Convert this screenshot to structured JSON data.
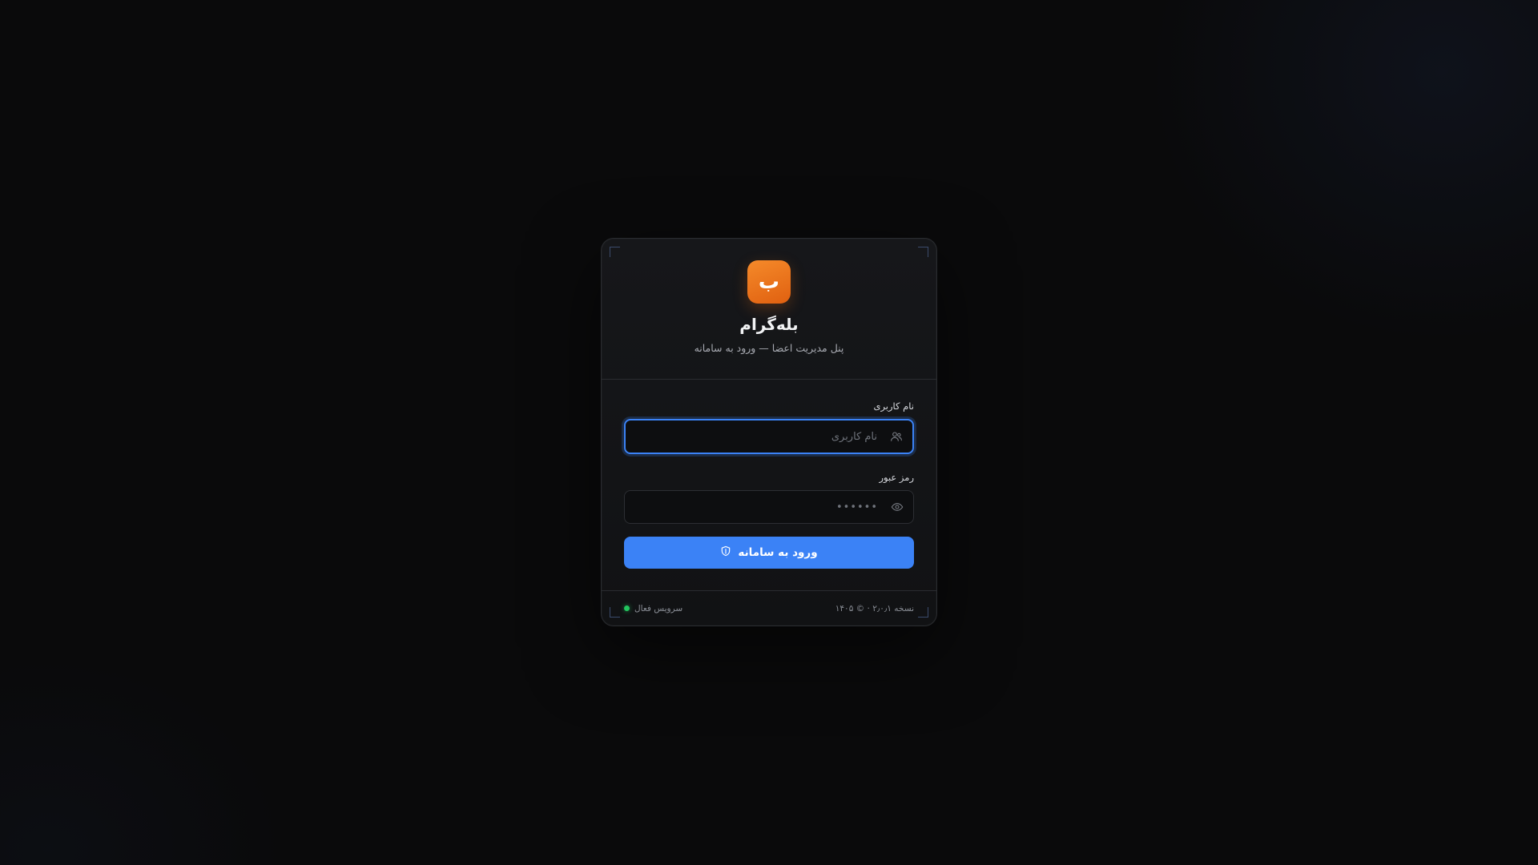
{
  "app": {
    "logo_letter": "ب",
    "title": "بله‌گرام",
    "subtitle": "پنل مدیریت اعضا — ورود به سامانه"
  },
  "form": {
    "username": {
      "label": "نام کاربری",
      "placeholder": "نام کاربری",
      "value": "",
      "icon": "users-icon"
    },
    "password": {
      "label": "رمز عبور",
      "placeholder": "••••••",
      "value": "",
      "icon": "eye-icon"
    },
    "submit_label": "ورود به سامانه",
    "submit_icon": "shield-icon"
  },
  "footer": {
    "status_text": "سرویس فعال",
    "version_text": "نسخه ۲٫۰٫۱ · © ۱۴۰۵"
  },
  "colors": {
    "accent": "#3b82f6",
    "brand": "#f07a1c",
    "status_ok": "#22c55e"
  }
}
